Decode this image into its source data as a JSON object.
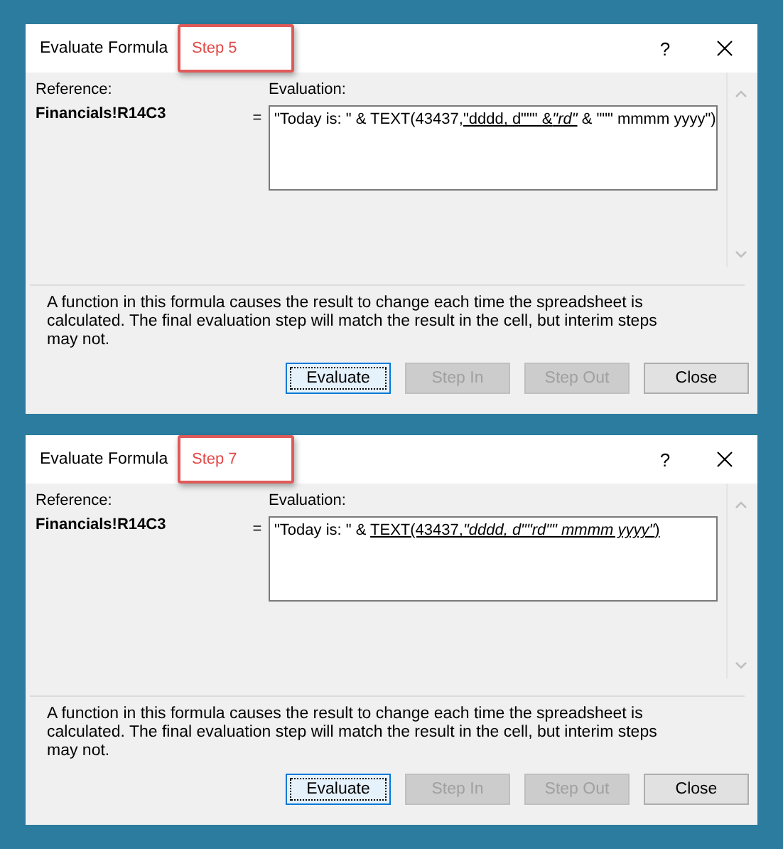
{
  "dialogs": [
    {
      "title": "Evaluate Formula",
      "callout": "Step 5",
      "help": "?",
      "reference_label": "Reference:",
      "reference": "Financials!R14C3",
      "equals": "=",
      "evaluation_label": "Evaluation:",
      "evaluation": [
        {
          "text": "\"Today is: \" & TEXT(43437,",
          "underlined": false,
          "italic": false
        },
        {
          "text": "\"dddd, d\"\"\" &",
          "underlined": true,
          "italic": false
        },
        {
          "text": "\"rd\"",
          "underlined": true,
          "italic": true
        },
        {
          "text": " & \"\"\" mmmm yyyy\")",
          "underlined": false,
          "italic": false
        }
      ],
      "message": "A function in this formula causes the result to change each time the spreadsheet is calculated.  The final evaluation step will match the result in the cell, but interim steps may not.",
      "buttons": [
        {
          "label": "Evaluate",
          "focused": true,
          "disabled": false
        },
        {
          "label": "Step In",
          "focused": false,
          "disabled": true
        },
        {
          "label": "Step Out",
          "focused": false,
          "disabled": true
        },
        {
          "label": "Close",
          "focused": false,
          "disabled": false
        }
      ]
    },
    {
      "title": "Evaluate Formula",
      "callout": "Step 7",
      "help": "?",
      "reference_label": "Reference:",
      "reference": "Financials!R14C3",
      "equals": "=",
      "evaluation_label": "Evaluation:",
      "evaluation": [
        {
          "text": "\"Today is: \" & ",
          "underlined": false,
          "italic": false
        },
        {
          "text": "TEXT(43437,",
          "underlined": true,
          "italic": false
        },
        {
          "text": "\"dddd, d\"\"rd\"\" mmmm yyyy\"",
          "underlined": true,
          "italic": true
        },
        {
          "text": ")",
          "underlined": true,
          "italic": false
        }
      ],
      "message": "A function in this formula causes the result to change each time the spreadsheet is calculated.  The final evaluation step will match the result in the cell, but interim steps may not.",
      "buttons": [
        {
          "label": "Evaluate",
          "focused": true,
          "disabled": false
        },
        {
          "label": "Step In",
          "focused": false,
          "disabled": true
        },
        {
          "label": "Step Out",
          "focused": false,
          "disabled": true
        },
        {
          "label": "Close",
          "focused": false,
          "disabled": false
        }
      ]
    }
  ]
}
